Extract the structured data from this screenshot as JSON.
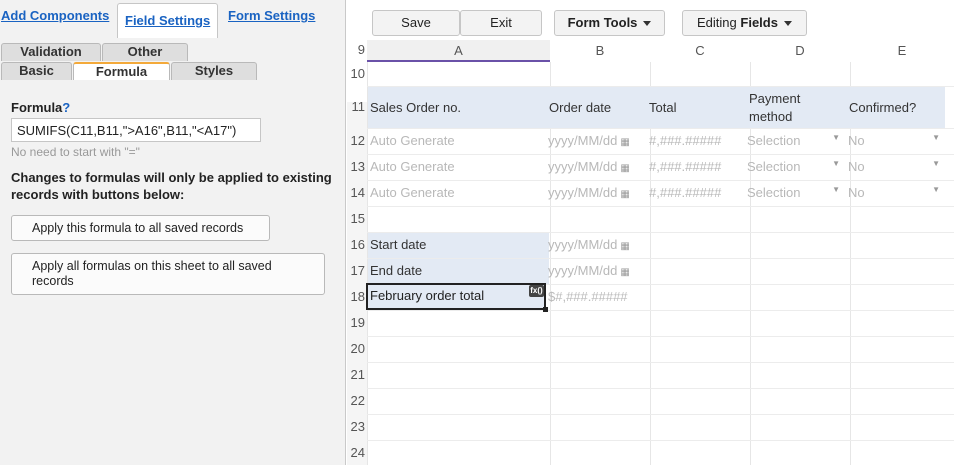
{
  "left_panel": {
    "top_tabs": [
      {
        "label": "Add Components"
      },
      {
        "label": "Field Settings"
      },
      {
        "label": "Form Settings"
      }
    ],
    "sub_tabs_row1": [
      {
        "label": "Validation"
      },
      {
        "label": "Other"
      }
    ],
    "sub_tabs_row2": [
      {
        "label": "Basic"
      },
      {
        "label": "Formula"
      },
      {
        "label": "Styles"
      }
    ],
    "formula": {
      "label": "Formula",
      "help": "?",
      "value": "SUMIFS(C11,B11,\">A16\",B11,\"<A17\")",
      "hint": "No need to start with \"=\"",
      "note": "Changes to formulas will only be applied to existing records with buttons below:",
      "apply_one_label": "Apply this formula to all saved records",
      "apply_all_label": "Apply all formulas on this sheet to all saved records"
    }
  },
  "toolbar": {
    "save_label": "Save",
    "exit_label": "Exit",
    "form_tools_label": "Form Tools",
    "editing_prefix": "Editing ",
    "editing_bold": "Fields"
  },
  "grid": {
    "columns": [
      "A",
      "B",
      "C",
      "D",
      "E"
    ],
    "rows": [
      "9",
      "10",
      "11",
      "12",
      "13",
      "14",
      "15",
      "16",
      "17",
      "18",
      "19",
      "20",
      "21",
      "22",
      "23",
      "24"
    ],
    "headers": {
      "a": "Sales Order no.",
      "b": "Order date",
      "c": "Total",
      "d": "Payment method",
      "e": "Confirmed?"
    },
    "data_rows": [
      {
        "a": "Auto Generate",
        "b": "yyyy/MM/dd",
        "c": "#,###.#####",
        "d": "Selection",
        "e": "No"
      },
      {
        "a": "Auto Generate",
        "b": "yyyy/MM/dd",
        "c": "#,###.#####",
        "d": "Selection",
        "e": "No"
      },
      {
        "a": "Auto Generate",
        "b": "yyyy/MM/dd",
        "c": "#,###.#####",
        "d": "Selection",
        "e": "No"
      }
    ],
    "fields": {
      "start_label": "Start date",
      "start_placeholder": "yyyy/MM/dd",
      "end_label": "End date",
      "end_placeholder": "yyyy/MM/dd",
      "total_label": "February order total",
      "total_placeholder": "$#,###.#####",
      "fx_badge": "fx()"
    }
  },
  "icons": {
    "calendar": "calendar-icon",
    "dropdown": "chevron-down-icon",
    "formula_badge": "fx-icon"
  },
  "colors": {
    "accent_blue": "#1a63c2",
    "header_fill": "#e3eaf4",
    "active_tab_top": "#f3a93a",
    "selected_column": "#6a51a8"
  }
}
